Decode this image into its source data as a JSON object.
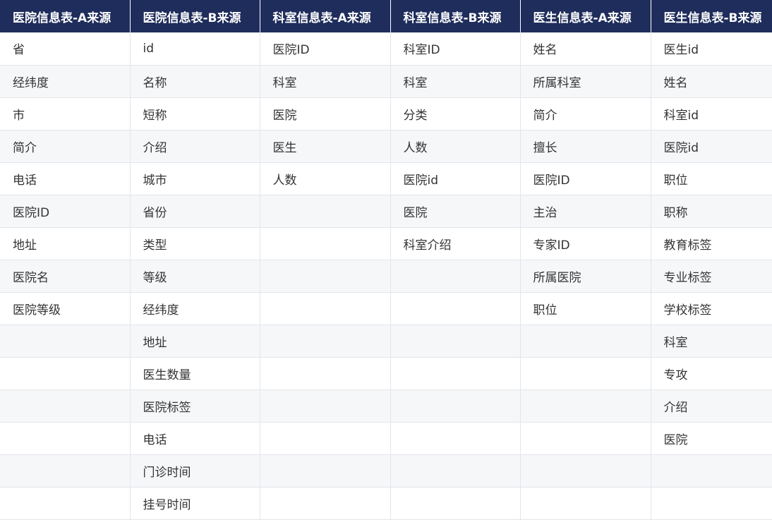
{
  "table": {
    "headers": [
      "医院信息表-A来源",
      "医院信息表-B来源",
      "科室信息表-A来源",
      "科室信息表-B来源",
      "医生信息表-A来源",
      "医生信息表-B来源"
    ],
    "rows": [
      [
        "省",
        "id",
        "医院ID",
        "科室ID",
        "姓名",
        "医生id"
      ],
      [
        "经纬度",
        "名称",
        "科室",
        "科室",
        "所属科室",
        "姓名"
      ],
      [
        "市",
        "短称",
        "医院",
        "分类",
        "简介",
        "科室id"
      ],
      [
        "简介",
        "介绍",
        "医生",
        "人数",
        "擅长",
        "医院id"
      ],
      [
        "电话",
        "城市",
        "人数",
        "医院id",
        "医院ID",
        "职位"
      ],
      [
        "医院ID",
        "省份",
        "",
        "医院",
        "主治",
        "职称"
      ],
      [
        "地址",
        "类型",
        "",
        "科室介绍",
        "专家ID",
        "教育标签"
      ],
      [
        "医院名",
        "等级",
        "",
        "",
        "所属医院",
        "专业标签"
      ],
      [
        "医院等级",
        "经纬度",
        "",
        "",
        "职位",
        "学校标签"
      ],
      [
        "",
        "地址",
        "",
        "",
        "",
        "科室"
      ],
      [
        "",
        "医生数量",
        "",
        "",
        "",
        "专攻"
      ],
      [
        "",
        "医院标签",
        "",
        "",
        "",
        "介绍"
      ],
      [
        "",
        "电话",
        "",
        "",
        "",
        "医院"
      ],
      [
        "",
        "门诊时间",
        "",
        "",
        "",
        ""
      ],
      [
        "",
        "挂号时间",
        "",
        "",
        "",
        ""
      ]
    ]
  },
  "colors": {
    "header_bg": "#1f2d5c",
    "header_text": "#ffffff",
    "row_alt_bg": "#f6f7f9",
    "border": "#e3e5ea",
    "cell_text": "#333333"
  }
}
